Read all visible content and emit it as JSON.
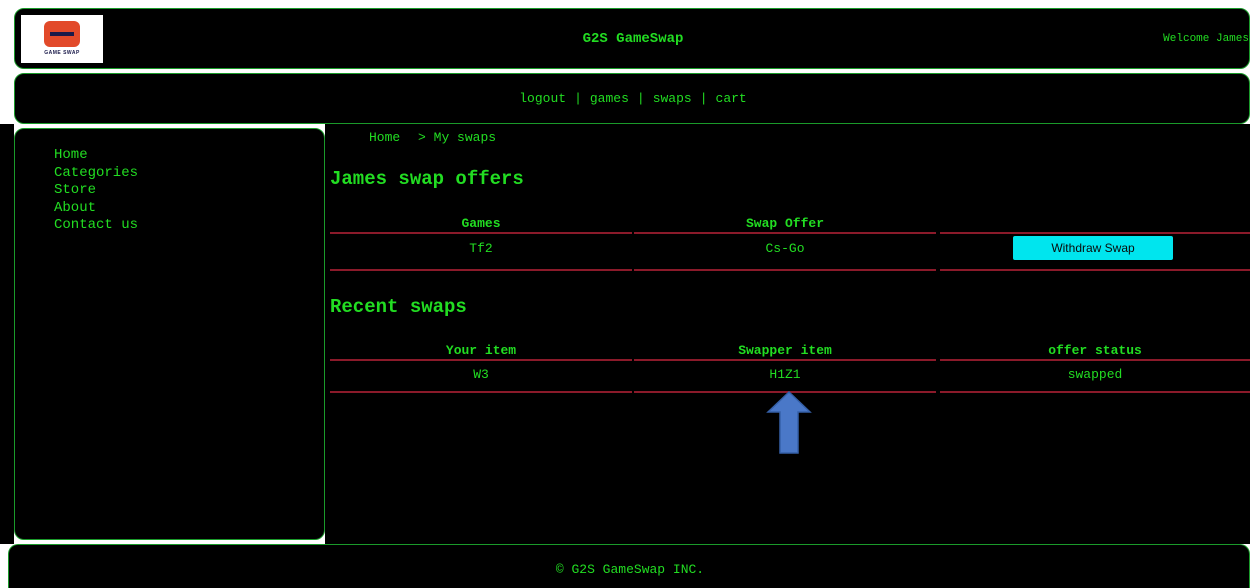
{
  "header": {
    "logo_text": "GAME SWAP",
    "title": "G2S GameSwap",
    "welcome": "Welcome James"
  },
  "nav": {
    "links": [
      "logout",
      "games",
      "swaps",
      "cart"
    ],
    "separator": "|"
  },
  "sidebar": {
    "items": [
      {
        "label": "Home"
      },
      {
        "label": "Categories"
      },
      {
        "label": "Store"
      },
      {
        "label": "About"
      },
      {
        "label": "Contact us"
      }
    ]
  },
  "breadcrumb": {
    "home": "Home",
    "arrow": ">",
    "current": "My swaps"
  },
  "offers": {
    "title": "James swap offers",
    "columns": [
      "Games",
      "Swap Offer",
      ""
    ],
    "rows": [
      {
        "game": "Tf2",
        "swap_offer": "Cs-Go",
        "action_label": "Withdraw Swap"
      }
    ]
  },
  "recent": {
    "title": "Recent swaps",
    "columns": [
      "Your item",
      "Swapper item",
      "offer status"
    ],
    "rows": [
      {
        "your_item": "W3",
        "swapper_item": "H1Z1",
        "status": "swapped"
      }
    ]
  },
  "footer": {
    "text": "© G2S GameSwap INC."
  },
  "colors": {
    "background": "#000000",
    "text": "#22dd22",
    "border": "#1a9a2a",
    "rule": "#8b1a2a",
    "button": "#00e5ee",
    "annotation_arrow": "#4a78c8"
  }
}
